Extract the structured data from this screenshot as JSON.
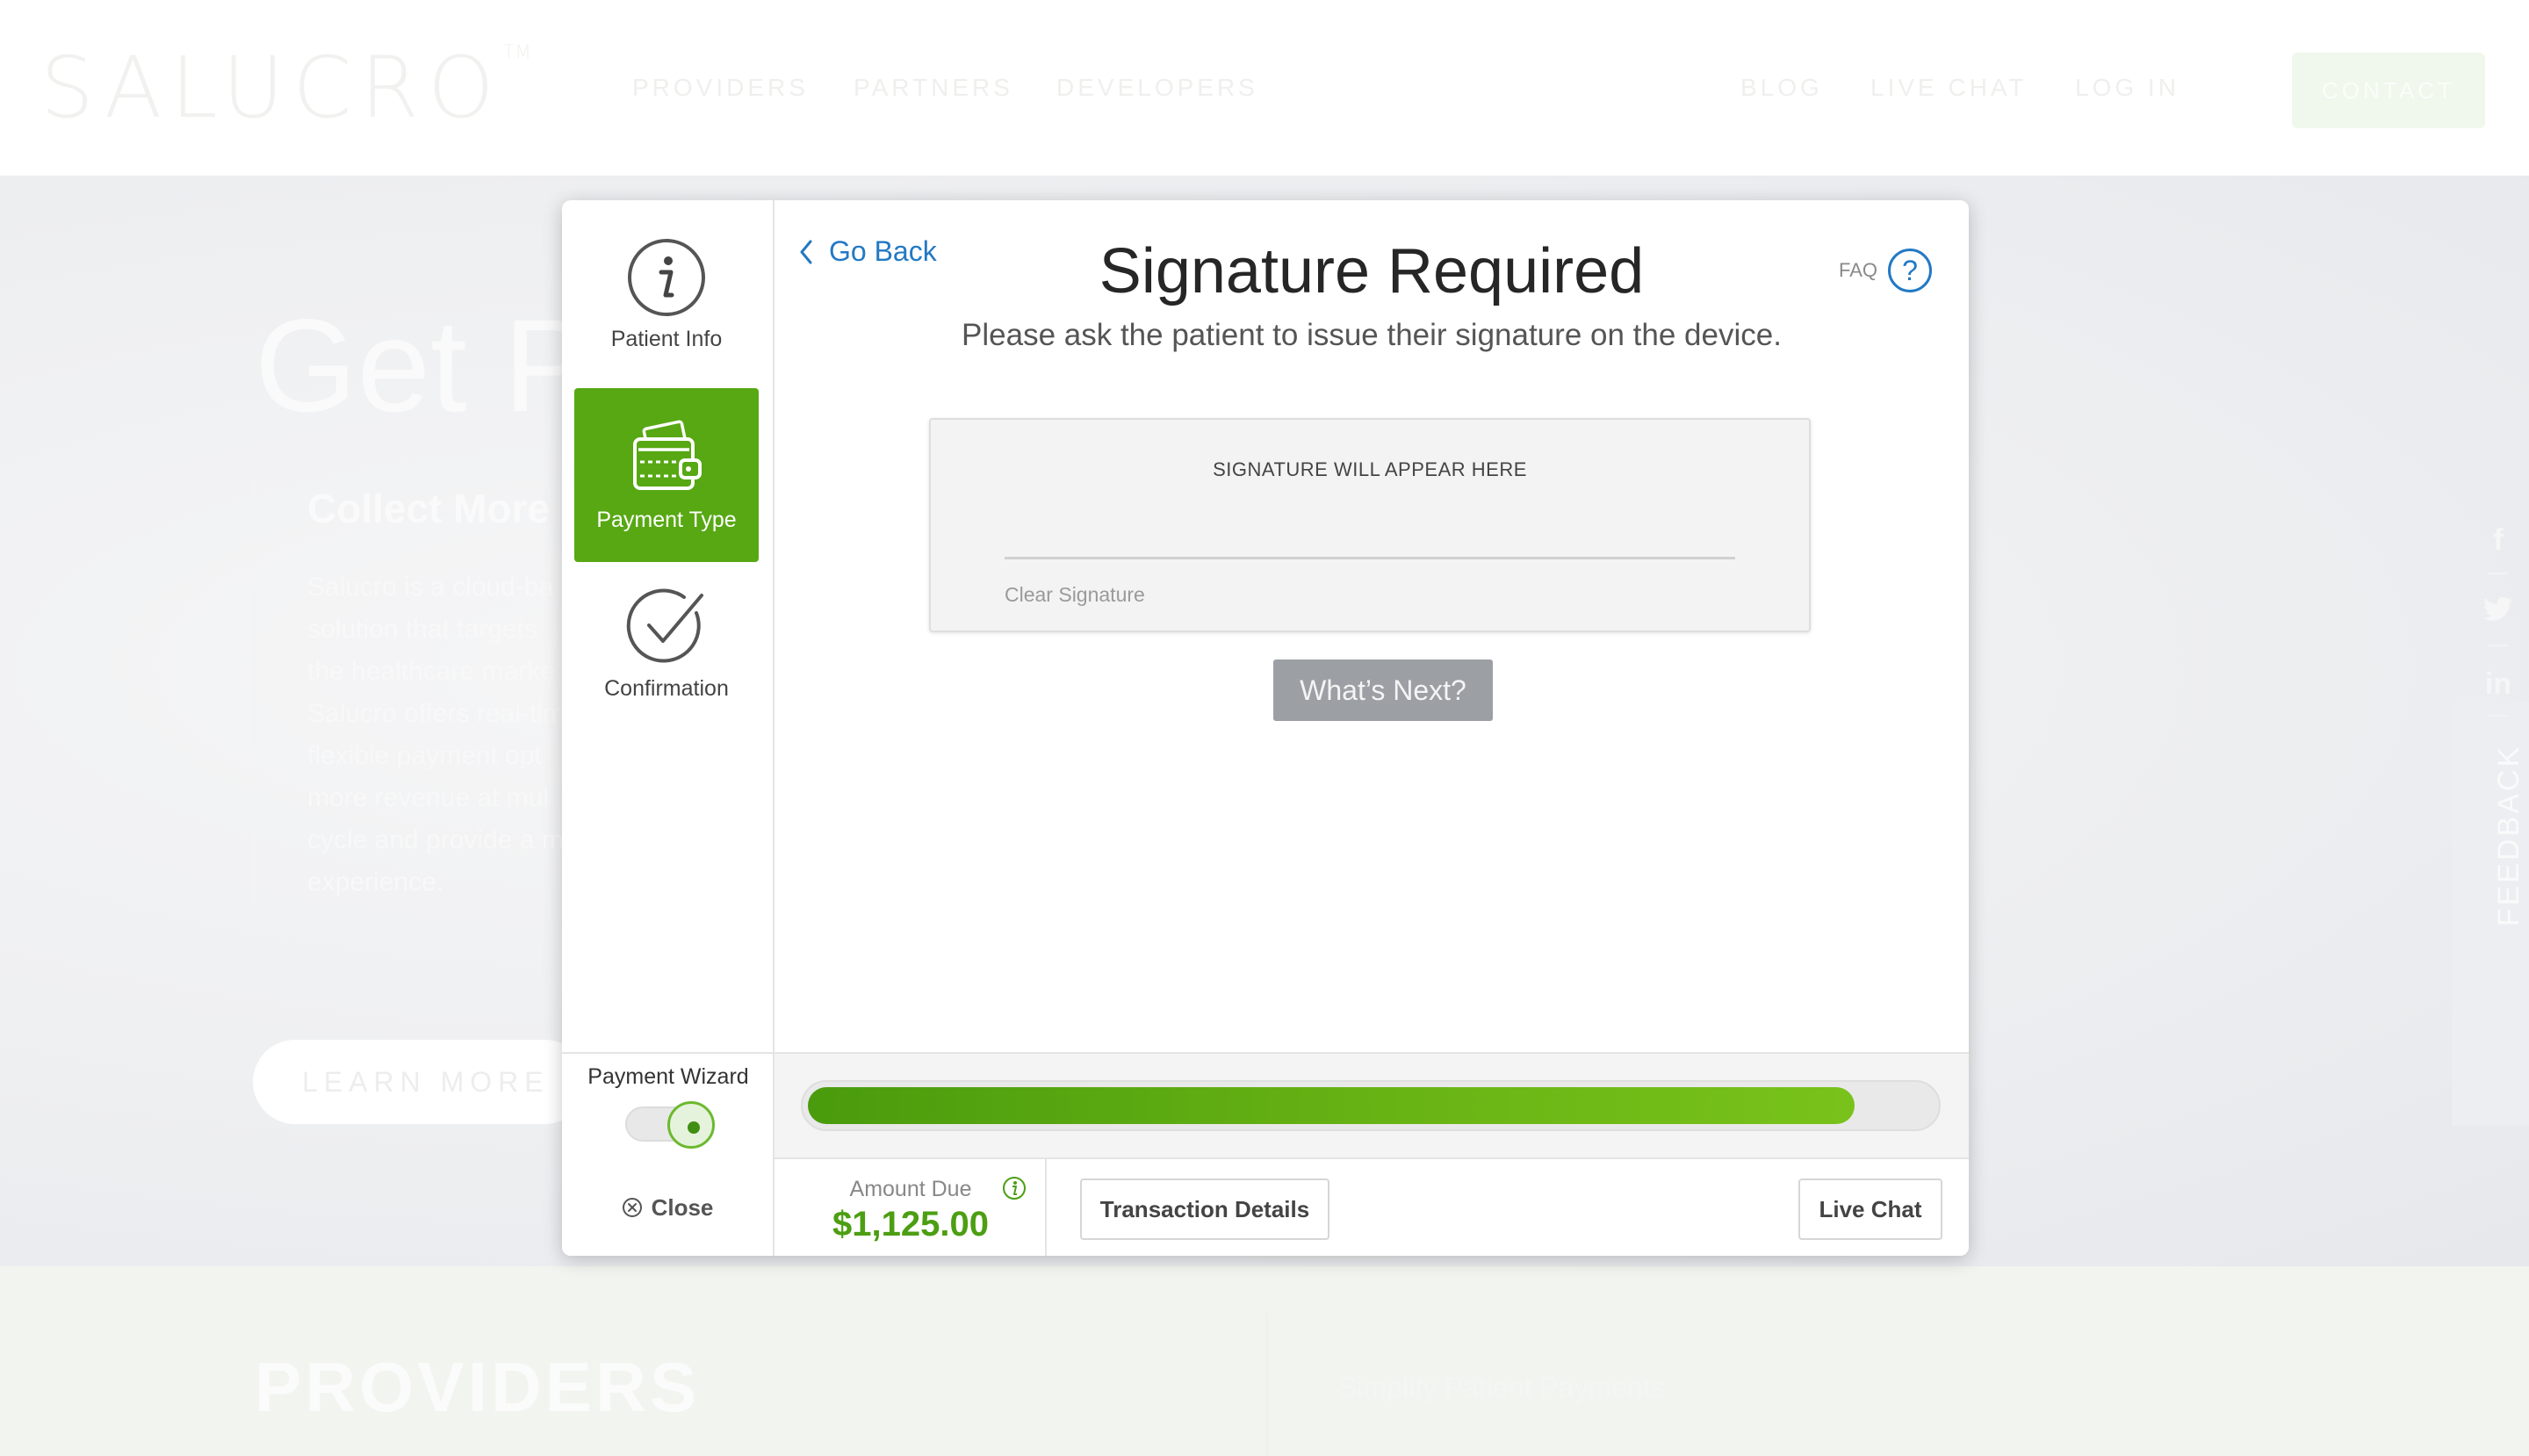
{
  "site": {
    "logo": "SALUCRO",
    "logo_tm": "TM",
    "nav_left": [
      "PROVIDERS",
      "PARTNERS",
      "DEVELOPERS"
    ],
    "nav_right": [
      "BLOG",
      "LIVE CHAT",
      "LOG IN"
    ],
    "contact_label": "CONTACT",
    "hero_title": "Get Pa",
    "hero_subtitle": "Collect More",
    "hero_paragraph": [
      "Salucro is a cloud-ba",
      "solution that targets",
      "the healthcare marke",
      "Salucro offers real-tim",
      "flexible payment opt",
      "more revenue at mul",
      "cycle and provide a m",
      "experience."
    ],
    "learn_more_label": "LEARN MORE",
    "social_icons": [
      "facebook-icon",
      "twitter-icon",
      "linkedin-icon"
    ],
    "feedback_label": "FEEDBACK",
    "providers_heading": "PROVIDERS",
    "providers_subheading": "Simplify Patient Payments"
  },
  "modal": {
    "steps": [
      {
        "label": "Patient Info",
        "icon": "info-icon",
        "active": false
      },
      {
        "label": "Payment Type",
        "icon": "wallet-icon",
        "active": true
      },
      {
        "label": "Confirmation",
        "icon": "check-circle-icon",
        "active": false
      }
    ],
    "go_back_label": "Go Back",
    "title": "Signature Required",
    "subtitle": "Please ask the patient to issue their signature on the device.",
    "faq_label": "FAQ",
    "faq_icon_glyph": "?",
    "signature_caption": "SIGNATURE WILL APPEAR HERE",
    "clear_signature_label": "Clear Signature",
    "whats_next_label": "What’s Next?",
    "wizard_label": "Payment Wizard",
    "wizard_enabled": true,
    "progress_fraction": 0.93,
    "close_label": "Close",
    "amount_due_label": "Amount Due",
    "amount_due_value": "$1,125.00",
    "transaction_details_label": "Transaction Details",
    "live_chat_label": "Live Chat"
  },
  "colors": {
    "accent_green": "#57a813",
    "link_blue": "#2279c4",
    "amount_green": "#4c9e12",
    "disabled_button": "#9c9fa4"
  }
}
